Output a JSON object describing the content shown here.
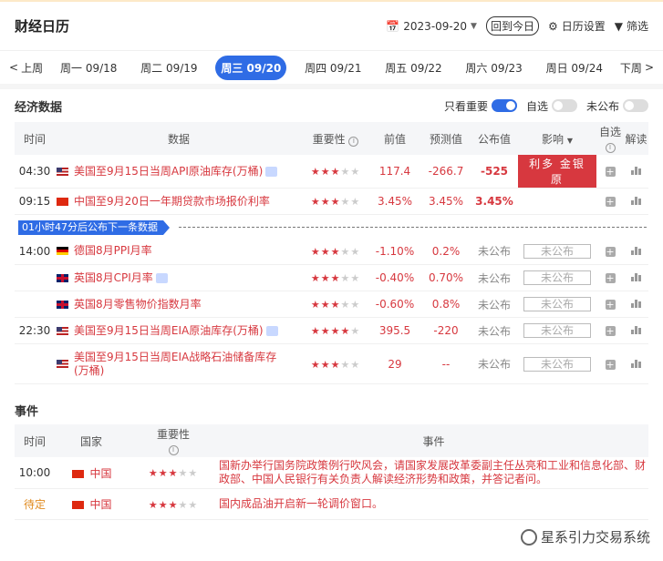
{
  "header": {
    "title": "财经日历",
    "date": "2023-09-20",
    "today_btn": "回到今日",
    "settings": "日历设置",
    "filter": "筛选"
  },
  "week": {
    "prev": "上周",
    "next": "下周",
    "days": [
      "周一 09/18",
      "周二 09/19",
      "周三 09/20",
      "周四 09/21",
      "周五 09/22",
      "周六 09/23",
      "周日 09/24"
    ]
  },
  "econ": {
    "title": "经济数据",
    "toggles": {
      "important": "只看重要",
      "selected": "自选",
      "unpublished": "未公布"
    },
    "columns": {
      "time": "时间",
      "data": "数据",
      "importance": "重要性",
      "previous": "前值",
      "forecast": "预测值",
      "actual": "公布值",
      "impact": "影响",
      "watch": "自选",
      "interpret": "解读"
    },
    "notice": "01小时47分后公布下一条数据",
    "rows": [
      {
        "time": "04:30",
        "flag": "us",
        "name": "美国至9月15日当周API原油库存(万桶)",
        "stars": 3,
        "previous": "117.4",
        "forecast": "-266.7",
        "actual": "-525",
        "impact": "利多 金银 原"
      },
      {
        "time": "09:15",
        "flag": "cn",
        "name": "中国至9月20日一年期贷款市场报价利率",
        "stars": 3,
        "previous": "3.45%",
        "forecast": "3.45%",
        "actual": "3.45%",
        "impact": ""
      },
      {
        "time": "14:00",
        "flag": "de",
        "name": "德国8月PPI月率",
        "stars": 3,
        "previous": "-1.10%",
        "forecast": "0.2%",
        "actual": "未公布",
        "impact": "未公布"
      },
      {
        "time": "",
        "flag": "gb",
        "name": "英国8月CPI月率",
        "stars": 3,
        "previous": "-0.40%",
        "forecast": "0.70%",
        "actual": "未公布",
        "impact": "未公布"
      },
      {
        "time": "",
        "flag": "gb",
        "name": "英国8月零售物价指数月率",
        "stars": 3,
        "previous": "-0.60%",
        "forecast": "0.8%",
        "actual": "未公布",
        "impact": "未公布"
      },
      {
        "time": "22:30",
        "flag": "us",
        "name": "美国至9月15日当周EIA原油库存(万桶)",
        "stars": 4,
        "previous": "395.5",
        "forecast": "-220",
        "actual": "未公布",
        "impact": "未公布"
      },
      {
        "time": "",
        "flag": "us",
        "name": "美国至9月15日当周EIA战略石油储备库存(万桶)",
        "stars": 3,
        "previous": "29",
        "forecast": "--",
        "actual": "未公布",
        "impact": "未公布"
      }
    ]
  },
  "events": {
    "title": "事件",
    "columns": {
      "time": "时间",
      "country": "国家",
      "importance": "重要性",
      "event": "事件"
    },
    "rows": [
      {
        "time": "10:00",
        "flag": "cn",
        "country": "中国",
        "stars": 3,
        "text": "国新办举行国务院政策例行吹风会，请国家发展改革委副主任丛亮和工业和信息化部、财政部、中国人民银行有关负责人解读经济形势和政策，并答记者问。"
      },
      {
        "time": "待定",
        "flag": "cn",
        "country": "中国",
        "stars": 3,
        "text": "国内成品油开启新一轮调价窗口。"
      }
    ]
  },
  "watermark": "星系引力交易系统"
}
